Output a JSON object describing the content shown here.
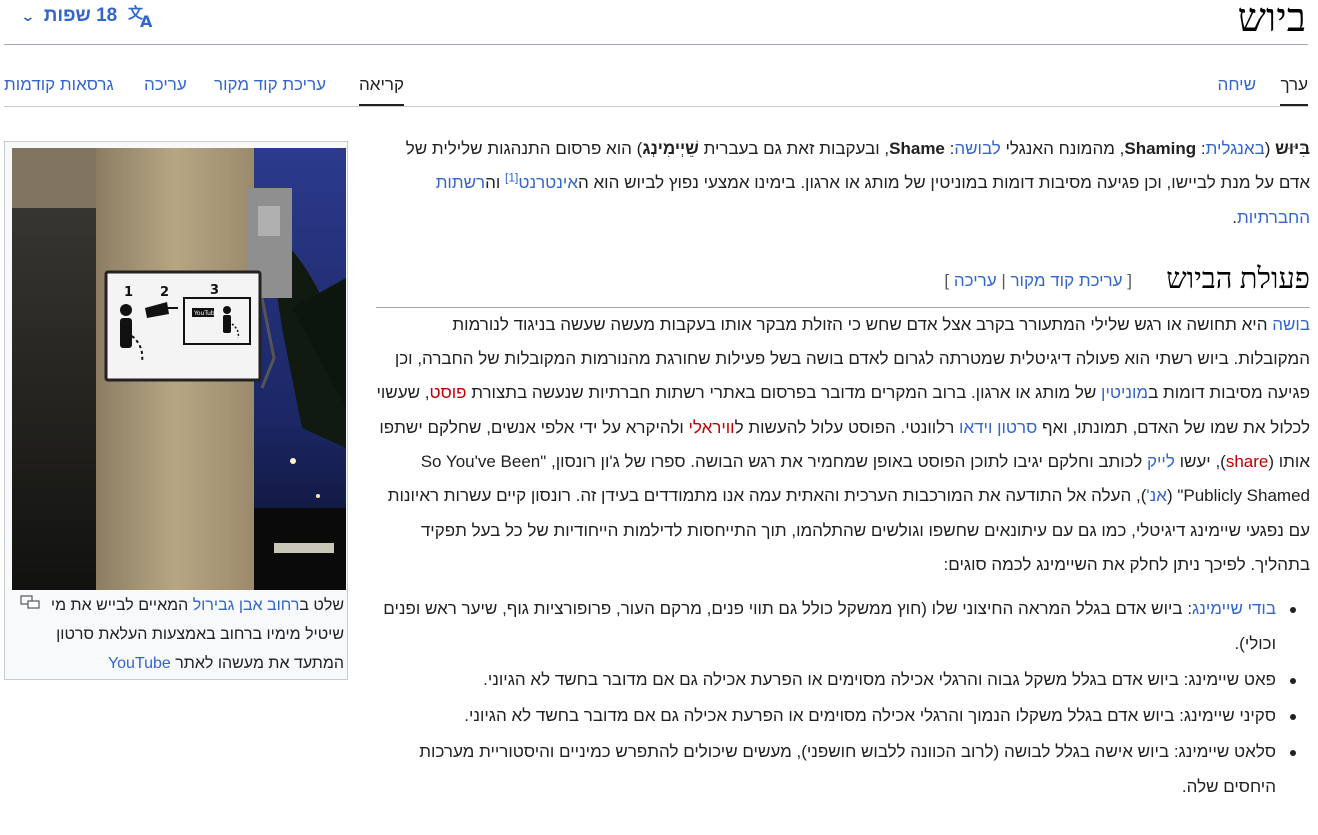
{
  "header": {
    "title": "ביוש",
    "languages_label": "18 שפות"
  },
  "tabs": {
    "article": "ערך",
    "talk": "שיחה",
    "read": "קריאה",
    "edit_source": "עריכת קוד מקור",
    "edit": "עריכה",
    "history": "גרסאות קודמות"
  },
  "intro": {
    "term": "בִּיּוּש",
    "open_paren": " (",
    "english_link": "באנגלית",
    "colon": ": ",
    "english_term": "Shaming",
    "t1": ", מהמונח האנגלי ",
    "shame_link": "לבושה",
    "colon2": ": ",
    "shame_en": "Shame",
    "t2": ", ובעקבות זאת גם בעברית ",
    "hebrew_term": "שֵׁיְימִינְג",
    "t3": ") הוא פרסום התנהגות שלילית של אדם על מנת לביישו, וכן פגיעה מסיבות דומות במוניטין של מותג או ארגון. בימינו אמצעי נפוץ לביוש הוא ה",
    "internet_link": "אינטרנט",
    "ref1": "[1]",
    "t4": " וה",
    "social_link": "רשתות החברתיות",
    "t5": "."
  },
  "section": {
    "heading": "פעולת הביוש",
    "edit_open": "[ ",
    "edit_source_link": "עריכת קוד מקור",
    "edit_sep": " | ",
    "edit_link": "עריכה",
    "edit_close": " ]",
    "p": {
      "shame_link": "בושה",
      "t1": " היא תחושה או רגש שלילי המתעורר בקרב אצל אדם שחש כי הזולת מבקר אותו בעקבות מעשה שעשה בניגוד לנורמות המקובלות. ביוש רשתי הוא פעולה דיגיטלית שמטרתה לגרום לאדם בושה בשל פעילות שחורגת מהנורמות המקובלות של החברה, וכן פגיעה מסיבות דומות ב",
      "reputation_link": "מוניטין",
      "t2": " של מותג או ארגון. ברוב המקרים מדובר בפרסום באתרי רשתות חברתיות שנעשה בתצורת ",
      "post_link": "פוסט",
      "t3": ", שעשוי לכלול את שמו של האדם, תמונתו, ואף ",
      "video_link": "סרטון וידאו",
      "t4": " רלוונטי. הפוסט עלול להעשות ל",
      "viral_link": "וויראלי",
      "t5": " ולהיקרא על ידי אלפי אנשים, שחלקם ישתפו אותו (",
      "share_link": "share",
      "t6": "), יעשו ",
      "like_link": "לייק",
      "t7": " לכותב וחלקם יגיבו לתוכן הפוסט באופן שמחמיר את רגש הבושה. ספרו של ג'ון רונסון, \"",
      "book_title": "So You've Been Publicly Shamed",
      "t8": "\" (",
      "en_link": "אנ'",
      "t9": "), העלה אל התודעה את המורכבות הערכית והאתית עמה אנו מתמודדים בעידן זה. רונסון קיים עשרות ראיונות עם נפגעי שיימינג דיגיטלי, כמו גם עם עיתונאים שחשפו וגולשים שהתלהמו, תוך התייחסות לדילמות הייחודיות של כל בעל תפקיד בתהליך. לפיכך ניתן לחלק את השיימינג לכמה סוגים:"
    },
    "types": [
      {
        "link": "בודי שיימינג",
        "text": ": ביוש אדם בגלל המראה החיצוני שלו (חוץ ממשקל כולל גם תווי פנים, מרקם העור, פרופורציות גוף, שיער ראש ופנים וכולי)."
      },
      {
        "link": "",
        "text": "פאט שיימינג: ביוש אדם בגלל משקל גבוה והרגלי אכילה מסוימים או הפרעת אכילה גם אם מדובר בחשד לא הגיוני."
      },
      {
        "link": "",
        "text": "סקיני שיימינג: ביוש אדם בגלל משקלו הנמוך והרגלי אכילה מסוימים או הפרעת אכילה גם אם מדובר בחשד לא הגיוני."
      },
      {
        "link": "",
        "text": "סלאט שיימינג: ביוש אישה בגלל לבושה (לרוב הכוונה ללבוש חושפני), מעשים שיכולים להתפרש כמיניים והיסטוריית מערכות היחסים שלה."
      }
    ]
  },
  "thumb": {
    "sign_numbers": [
      "1",
      "2",
      "3"
    ],
    "sign_yt": "YouTube",
    "caption": {
      "t1": "שלט ב",
      "street_link": "רחוב אבן גבירול",
      "t2": " המאיים לבייש את מי שיטיל מימיו ברחוב באמצעות העלאת סרטון המתעד את מעשהו לאתר ",
      "yt_link": "YouTube"
    }
  }
}
